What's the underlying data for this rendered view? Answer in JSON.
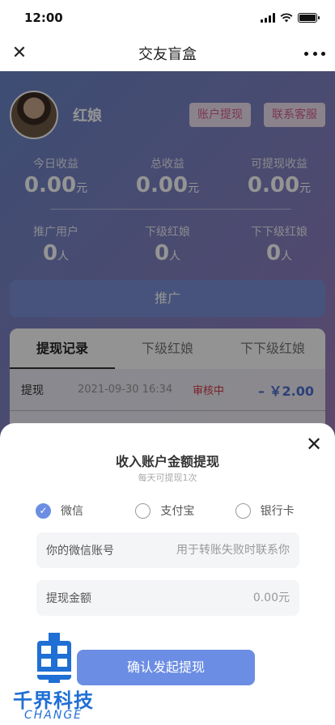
{
  "status_bar": {
    "time": "12:00"
  },
  "nav": {
    "title": "交友盲盒"
  },
  "profile": {
    "name": "红娘",
    "withdraw_account_label": "账户提现",
    "contact_service_label": "联系客服"
  },
  "earnings": [
    {
      "label": "今日收益",
      "value": "0.00",
      "unit": "元"
    },
    {
      "label": "总收益",
      "value": "0.00",
      "unit": "元"
    },
    {
      "label": "可提现收益",
      "value": "0.00",
      "unit": "元"
    }
  ],
  "users": [
    {
      "label": "推广用户",
      "value": "0",
      "unit": "人"
    },
    {
      "label": "下级红娘",
      "value": "0",
      "unit": "人"
    },
    {
      "label": "下下级红娘",
      "value": "0",
      "unit": "人"
    }
  ],
  "promote_label": "推广",
  "tabs": [
    {
      "label": "提现记录",
      "active": true
    },
    {
      "label": "下级红娘",
      "active": false
    },
    {
      "label": "下下级红娘",
      "active": false
    }
  ],
  "records": [
    {
      "type": "提现",
      "time": "2021-09-30  16:34",
      "status": "审核中",
      "amount": "– ￥2.00"
    }
  ],
  "modal": {
    "title": "收入账户金额提现",
    "subtitle": "每天可提现1次",
    "methods": [
      {
        "label": "微信",
        "selected": true
      },
      {
        "label": "支付宝",
        "selected": false
      },
      {
        "label": "银行卡",
        "selected": false
      }
    ],
    "account_field": {
      "label": "你的微信账号",
      "placeholder": "用于转账失败时联系你",
      "value": ""
    },
    "amount_field": {
      "label": "提现金额",
      "placeholder": "0.00元",
      "value": ""
    },
    "confirm_label": "确认发起提现"
  },
  "watermark": {
    "brand": "千界科技",
    "sub": "CHANGE"
  },
  "colors": {
    "accent": "#6b8de3",
    "status_pending": "#d43a4a",
    "amount": "#4b6fd0",
    "brand": "#1f6fd4"
  }
}
